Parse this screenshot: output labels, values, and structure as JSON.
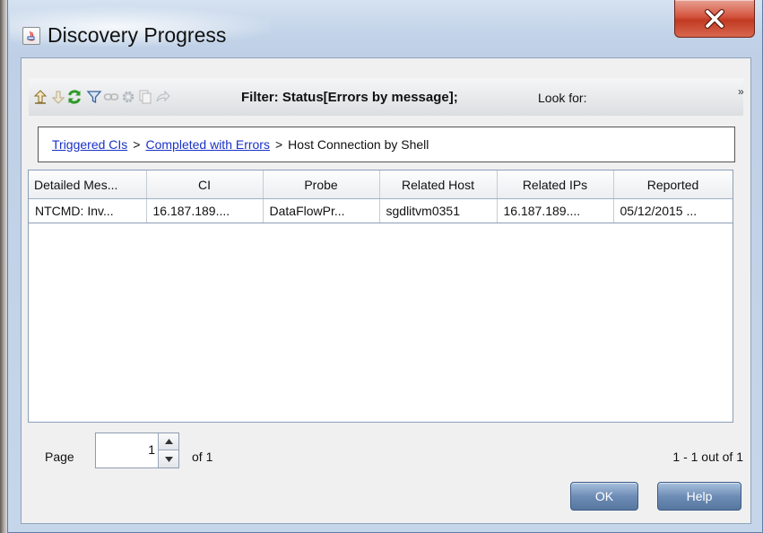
{
  "window": {
    "title": "Discovery Progress",
    "close_label": "X"
  },
  "toolbar": {
    "icons": [
      "move-up-icon",
      "move-down-icon",
      "refresh-icon",
      "filter-icon",
      "link-icon",
      "settings-icon",
      "copy-icon",
      "forward-icon"
    ],
    "filter_text": "Filter: Status[Errors by message];",
    "look_for_label": "Look for:",
    "overflow": "»"
  },
  "breadcrumb": {
    "items": [
      {
        "label": "Triggered CIs",
        "link": true
      },
      {
        "label": "Completed with Errors",
        "link": true
      },
      {
        "label": "Host Connection by Shell",
        "link": false
      }
    ],
    "separator": ">"
  },
  "table": {
    "columns": [
      "Detailed Mes...",
      "CI",
      "Probe",
      "Related Host",
      "Related IPs",
      "Reported"
    ],
    "rows": [
      [
        "NTCMD: Inv...",
        "16.187.189....",
        "DataFlowPr...",
        "sgdlitvm0351",
        "16.187.189....",
        "05/12/2015 ..."
      ]
    ]
  },
  "pagination": {
    "page_label": "Page",
    "page_value": "1",
    "of_label": "of 1",
    "range_label": "1 - 1 out of 1"
  },
  "buttons": {
    "ok": "OK",
    "help": "Help"
  },
  "colors": {
    "link": "#1a32c8",
    "close_button": "#c23a22",
    "dialog_button": "#6e8db6"
  }
}
